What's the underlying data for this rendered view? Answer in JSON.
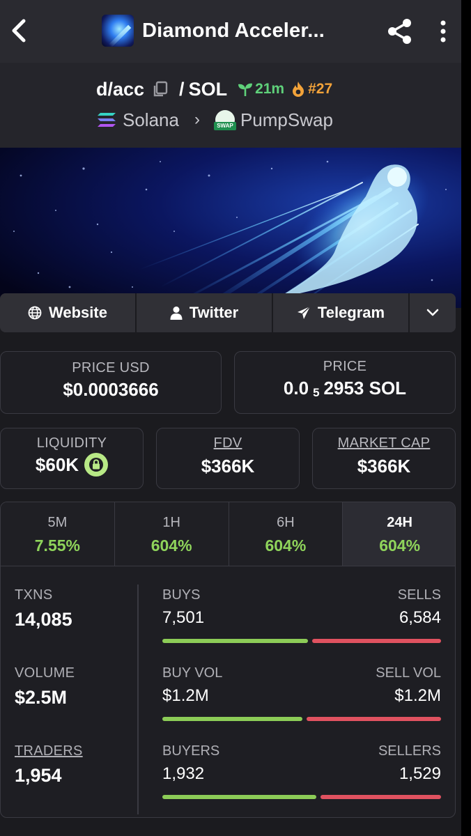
{
  "header": {
    "title": "Diamond Acceler...",
    "back_icon": "chevron-left-icon",
    "share_icon": "share-icon",
    "more_icon": "more-vertical-icon"
  },
  "pair": {
    "base": "d/acc",
    "separator": "/",
    "quote": "SOL",
    "age": "21m",
    "rank": "#27",
    "chain": "Solana",
    "dex": "PumpSwap",
    "dex_badge": "SWAP"
  },
  "links": [
    {
      "label": "Website",
      "icon": "globe-icon"
    },
    {
      "label": "Twitter",
      "icon": "user-icon"
    },
    {
      "label": "Telegram",
      "icon": "send-icon"
    }
  ],
  "price": {
    "usd_label": "PRICE USD",
    "usd_value": "$0.0003666",
    "native_label": "PRICE",
    "native_prefix": "0.0",
    "native_zeros": "5",
    "native_suffix": "2953 SOL"
  },
  "metrics": {
    "liquidity_label": "LIQUIDITY",
    "liquidity_value": "$60K",
    "fdv_label": "FDV",
    "fdv_value": "$366K",
    "mcap_label": "MARKET CAP",
    "mcap_value": "$366K"
  },
  "timeframes": [
    {
      "label": "5M",
      "value": "7.55%"
    },
    {
      "label": "1H",
      "value": "604%"
    },
    {
      "label": "6H",
      "value": "604%"
    },
    {
      "label": "24H",
      "value": "604%",
      "active": true
    }
  ],
  "stats": {
    "txns_label": "TXNS",
    "txns_value": "14,085",
    "buys_label": "BUYS",
    "buys_value": "7,501",
    "sells_label": "SELLS",
    "sells_value": "6,584",
    "volume_label": "VOLUME",
    "volume_value": "$2.5M",
    "buy_vol_label": "BUY VOL",
    "buy_vol_value": "$1.2M",
    "sell_vol_label": "SELL VOL",
    "sell_vol_value": "$1.2M",
    "traders_label": "TRADERS",
    "traders_value": "1,954",
    "buyers_label": "BUYERS",
    "buyers_value": "1,932",
    "sellers_label": "SELLERS",
    "sellers_value": "1,529",
    "txns_buy_fraction": 0.53,
    "vol_buy_fraction": 0.51,
    "traders_buy_fraction": 0.56
  },
  "colors": {
    "accent_green": "#8ccc57",
    "accent_red": "#e05260",
    "age_green": "#5fd17a",
    "rank_orange": "#f3a33a"
  }
}
